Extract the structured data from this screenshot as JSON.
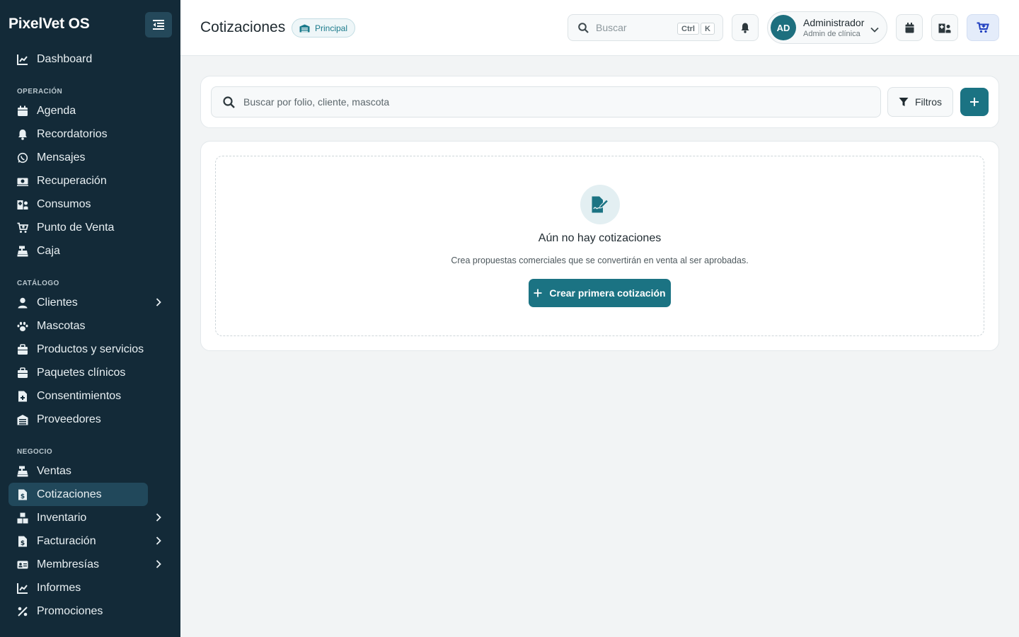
{
  "app": {
    "brand": "PixelVet OS"
  },
  "sidebar": {
    "top_items": [
      {
        "label": "Dashboard",
        "icon": "chart-line-icon"
      }
    ],
    "sections": [
      {
        "label": "OPERACIÓN",
        "items": [
          {
            "label": "Agenda",
            "icon": "calendar-icon"
          },
          {
            "label": "Recordatorios",
            "icon": "bell-icon"
          },
          {
            "label": "Mensajes",
            "icon": "whatsapp-icon"
          },
          {
            "label": "Recuperación",
            "icon": "money-bill-icon"
          },
          {
            "label": "Consumos",
            "icon": "hospital-user-icon"
          },
          {
            "label": "Punto de Venta",
            "icon": "cart-plus-icon"
          },
          {
            "label": "Caja",
            "icon": "cash-register-icon"
          }
        ]
      },
      {
        "label": "CATÁLOGO",
        "items": [
          {
            "label": "Clientes",
            "icon": "user-icon",
            "expandable": true
          },
          {
            "label": "Mascotas",
            "icon": "paw-icon"
          },
          {
            "label": "Productos y servicios",
            "icon": "box-icon"
          },
          {
            "label": "Paquetes clínicos",
            "icon": "briefcase-medical-icon"
          },
          {
            "label": "Consentimientos",
            "icon": "file-medical-icon"
          },
          {
            "label": "Proveedores",
            "icon": "warehouse-icon"
          }
        ]
      },
      {
        "label": "NEGOCIO",
        "items": [
          {
            "label": "Ventas",
            "icon": "cash-register-icon"
          },
          {
            "label": "Cotizaciones",
            "icon": "file-invoice-dollar-icon",
            "active": true
          },
          {
            "label": "Inventario",
            "icon": "boxes-icon",
            "expandable": true
          },
          {
            "label": "Facturación",
            "icon": "file-invoice-icon",
            "expandable": true
          },
          {
            "label": "Membresías",
            "icon": "id-card-icon",
            "expandable": true
          },
          {
            "label": "Informes",
            "icon": "chart-line-icon"
          },
          {
            "label": "Promociones",
            "icon": "percent-icon"
          }
        ]
      }
    ]
  },
  "header": {
    "title": "Cotizaciones",
    "branch_badge": "Principal",
    "search_placeholder": "Buscar",
    "shortcut_keys": [
      "Ctrl",
      "K"
    ],
    "user": {
      "initials": "AD",
      "name": "Administrador",
      "role": "Admin de clínica"
    }
  },
  "filters": {
    "search_placeholder": "Buscar por folio, cliente, mascota",
    "filters_label": "Filtros"
  },
  "empty_state": {
    "title": "Aún no hay cotizaciones",
    "description": "Crea propuestas comerciales que se convertirán en venta al ser aprobadas.",
    "cta_label": "Crear primera cotización"
  },
  "colors": {
    "sidebar_bg": "#132a38",
    "accent": "#1b7383",
    "active_item_bg": "#21485b"
  }
}
